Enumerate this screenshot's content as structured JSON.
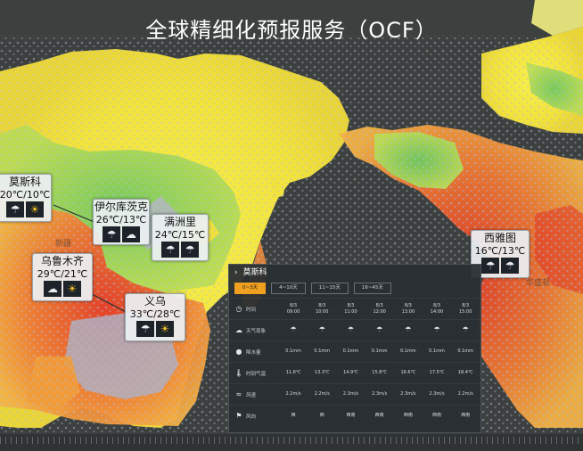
{
  "title": "全球精细化预报服务（OCF）",
  "cities": [
    {
      "name": "莫斯科",
      "temp": "20℃/10℃",
      "icons": [
        "rain-cloud-icon",
        "sun-icon"
      ]
    },
    {
      "name": "伊尔库茨克",
      "temp": "26℃/13℃",
      "icons": [
        "rain-cloud-icon",
        "cloud-icon"
      ]
    },
    {
      "name": "满洲里",
      "temp": "24℃/15℃",
      "icons": [
        "rain-cloud-icon",
        "rain-cloud-icon"
      ]
    },
    {
      "name": "乌鲁木齐",
      "temp": "29℃/21℃",
      "icons": [
        "cloud-icon",
        "sun-icon"
      ]
    },
    {
      "name": "义乌",
      "temp": "33℃/28℃",
      "icons": [
        "rain-cloud-icon",
        "sun-icon"
      ]
    },
    {
      "name": "西雅图",
      "temp": "16℃/13℃",
      "icons": [
        "rain-cloud-icon",
        "rain-cloud-icon"
      ]
    }
  ],
  "map_labels": {
    "xinjiang": "新疆",
    "washington": "华盛顿"
  },
  "panel": {
    "city": "莫斯科",
    "tabs": [
      "0~3天",
      "4~10天",
      "11~15天",
      "16~45天"
    ],
    "active_tab": 0,
    "columns": [
      {
        "date": "8/3",
        "time": "09:00",
        "weather": "rain-cloud-icon",
        "precip": "0.1mm",
        "temp": "11.8℃",
        "wind_speed": "2.2m/s",
        "wind_dir": "西"
      },
      {
        "date": "8/3",
        "time": "10:00",
        "weather": "rain-cloud-icon",
        "precip": "0.1mm",
        "temp": "13.3℃",
        "wind_speed": "2.2m/s",
        "wind_dir": "西"
      },
      {
        "date": "8/3",
        "time": "11:00",
        "weather": "rain-cloud-icon",
        "precip": "0.1mm",
        "temp": "14.9℃",
        "wind_speed": "2.3m/s",
        "wind_dir": "西南"
      },
      {
        "date": "8/3",
        "time": "12:00",
        "weather": "rain-cloud-icon",
        "precip": "0.1mm",
        "temp": "15.8℃",
        "wind_speed": "2.3m/s",
        "wind_dir": "西南"
      },
      {
        "date": "8/3",
        "time": "13:00",
        "weather": "rain-cloud-icon",
        "precip": "0.1mm",
        "temp": "16.6℃",
        "wind_speed": "2.3m/s",
        "wind_dir": "西南"
      },
      {
        "date": "8/3",
        "time": "14:00",
        "weather": "rain-cloud-icon",
        "precip": "0.1mm",
        "temp": "17.5℃",
        "wind_speed": "2.3m/s",
        "wind_dir": "西南"
      },
      {
        "date": "8/3",
        "time": "15:00",
        "weather": "rain-cloud-icon",
        "precip": "0.1mm",
        "temp": "18.4℃",
        "wind_speed": "2.2m/s",
        "wind_dir": "西南"
      }
    ],
    "rows": [
      {
        "key": "time",
        "label": "时间",
        "icon": "clock-icon"
      },
      {
        "key": "weather",
        "label": "天气现象",
        "icon": "weather-icon"
      },
      {
        "key": "precip",
        "label": "降水量",
        "icon": "droplet-icon"
      },
      {
        "key": "temp",
        "label": "时刻气温",
        "icon": "thermometer-icon"
      },
      {
        "key": "wind_speed",
        "label": "风速",
        "icon": "wind-icon"
      },
      {
        "key": "wind_dir",
        "label": "风向",
        "icon": "wind-direction-icon"
      }
    ]
  },
  "colors": {
    "background": "#3c403f",
    "cold": "#f5e83a",
    "mild": "#8fd05a",
    "hot": "#e8402a",
    "accent": "#f0a020"
  }
}
